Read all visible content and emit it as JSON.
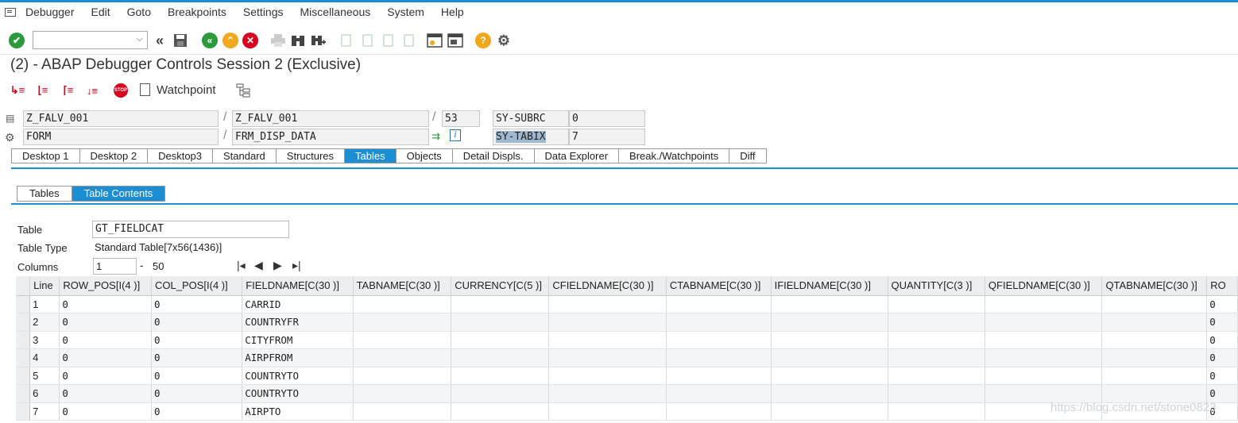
{
  "menubar": {
    "items": [
      "Debugger",
      "Edit",
      "Goto",
      "Breakpoints",
      "Settings",
      "Miscellaneous",
      "System",
      "Help"
    ]
  },
  "toolbar": {
    "command_field_value": ""
  },
  "title": "(2) - ABAP Debugger Controls Session 2 (Exclusive)",
  "controls": {
    "watchpoint_label": "Watchpoint",
    "stop_label": "STOP"
  },
  "info": {
    "program1": "Z_FALV_001",
    "program2": "Z_FALV_001",
    "line": "53",
    "event_type": "FORM",
    "event_name": "FRM_DISP_DATA",
    "sy_subrc_label": "SY-SUBRC",
    "sy_subrc_value": "0",
    "sy_tabix_label": "SY-TABIX",
    "sy_tabix_value": "7",
    "slash": "/"
  },
  "tabs": [
    "Desktop 1",
    "Desktop 2",
    "Desktop3",
    "Standard",
    "Structures",
    "Tables",
    "Objects",
    "Detail Displs.",
    "Data Explorer",
    "Break./Watchpoints",
    "Diff"
  ],
  "active_tab": "Tables",
  "subtabs": [
    "Tables",
    "Table Contents"
  ],
  "active_subtab": "Table Contents",
  "table_meta": {
    "table_label": "Table",
    "table_value": "GT_FIELDCAT",
    "type_label": "Table Type",
    "type_value": "Standard Table[7x56(1436)]",
    "columns_label": "Columns",
    "columns_from": "1",
    "columns_sep": "-",
    "columns_to": "50"
  },
  "grid": {
    "headers": [
      "Line",
      "ROW_POS[I(4 )]",
      "COL_POS[I(4 )]",
      "FIELDNAME[C(30 )]",
      "TABNAME[C(30 )]",
      "CURRENCY[C(5 )]",
      "CFIELDNAME[C(30 )]",
      "CTABNAME[C(30 )]",
      "IFIELDNAME[C(30 )]",
      "QUANTITY[C(3 )]",
      "QFIELDNAME[C(30 )]",
      "QTABNAME[C(30 )]",
      "RO"
    ],
    "rows": [
      [
        "1",
        "0",
        "0",
        "CARRID",
        "",
        "",
        "",
        "",
        "",
        "",
        "",
        "",
        "0"
      ],
      [
        "2",
        "0",
        "0",
        "COUNTRYFR",
        "",
        "",
        "",
        "",
        "",
        "",
        "",
        "",
        "0"
      ],
      [
        "3",
        "0",
        "0",
        "CITYFROM",
        "",
        "",
        "",
        "",
        "",
        "",
        "",
        "",
        "0"
      ],
      [
        "4",
        "0",
        "0",
        "AIRPFROM",
        "",
        "",
        "",
        "",
        "",
        "",
        "",
        "",
        "0"
      ],
      [
        "5",
        "0",
        "0",
        "COUNTRYTO",
        "",
        "",
        "",
        "",
        "",
        "",
        "",
        "",
        "0"
      ],
      [
        "6",
        "0",
        "0",
        "COUNTRYTO",
        "",
        "",
        "",
        "",
        "",
        "",
        "",
        "",
        "0"
      ],
      [
        "7",
        "0",
        "0",
        "AIRPTO",
        "",
        "",
        "",
        "",
        "",
        "",
        "",
        "",
        "0"
      ]
    ]
  },
  "watermark": "https://blog.csdn.net/stone0823",
  "colors": {
    "accent": "#1c8ed3",
    "ok_green": "#2d9a3c",
    "back_green": "#2d9a3c",
    "exit_orange": "#f0a81c",
    "cancel_red": "#d8001c",
    "help_orange": "#f0a81c"
  }
}
